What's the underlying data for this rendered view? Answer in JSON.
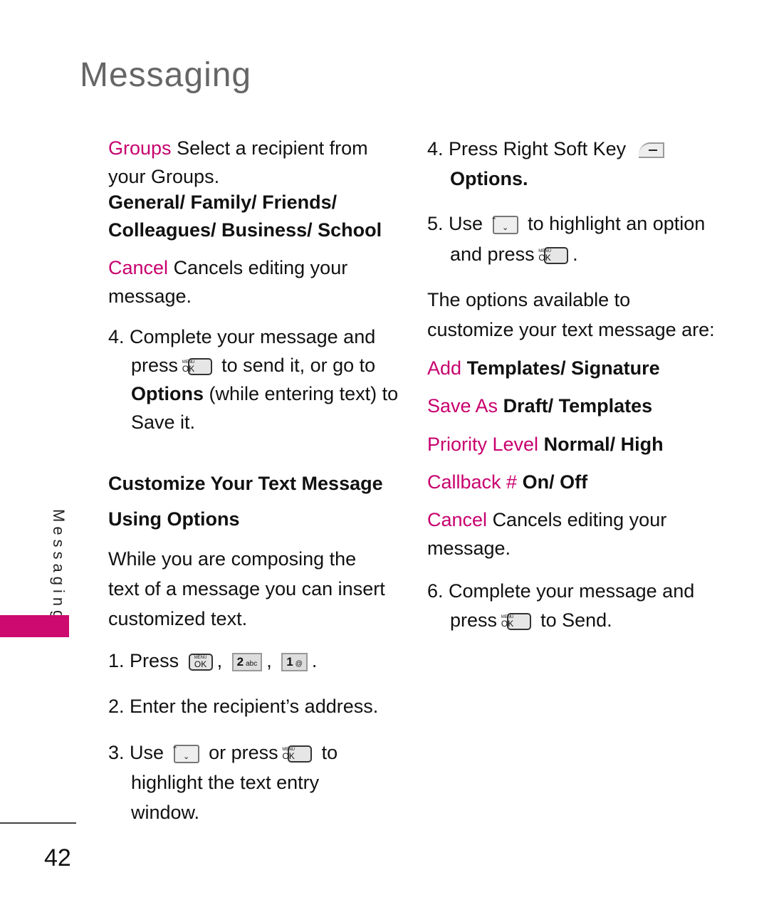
{
  "page_title": "Messaging",
  "side_tab": "Messaging",
  "page_number": "42",
  "left": {
    "groups": {
      "term": "Groups",
      "desc": "Select a recipient from your Groups.",
      "options": "General/ Family/ Friends/ Colleagues/ Business/ School"
    },
    "cancel": {
      "term": "Cancel",
      "desc": "Cancels editing your message."
    },
    "step4": {
      "num": "4.",
      "a": "Complete your message and press",
      "b": "to send it, or go to",
      "c": "Options",
      "d": "(while entering text) to Save it."
    },
    "heading": "Customize Your Text Message Using Options",
    "intro": "While you are composing the text of a message you can insert customized text.",
    "step1": {
      "num": "1.",
      "a": "Press",
      "sep": ",",
      "end": "."
    },
    "step2": {
      "num": "2.",
      "text": "Enter the recipient’s address."
    },
    "step3": {
      "num": "3.",
      "a": "Use",
      "b": "or press",
      "c": "to highlight the text entry window."
    }
  },
  "right": {
    "step4": {
      "num": "4.",
      "a": "Press Right Soft Key",
      "b": "Options."
    },
    "step5": {
      "num": "5.",
      "a": "Use",
      "b": "to highlight an option and press",
      "c": "."
    },
    "intro": "The options available to customize your text message are:",
    "options": [
      {
        "term": "Add",
        "value": "Templates/ Signature"
      },
      {
        "term": "Save As",
        "value": "Draft/ Templates"
      },
      {
        "term": "Priority Level",
        "value": "Normal/ High"
      },
      {
        "term": "Callback #",
        "value": "On/ Off"
      }
    ],
    "cancel": {
      "term": "Cancel",
      "desc": "Cancels editing your message."
    },
    "step6": {
      "num": "6.",
      "a": "Complete your message and press",
      "b": "to Send."
    }
  },
  "keys": {
    "menu": "MENU",
    "ok": "OK",
    "two": "2",
    "two_sub": "abc",
    "one": "1",
    "one_sub": "@",
    "nav_up": "⌃",
    "nav_down": "⌄"
  },
  "colors": {
    "accent": "#c8006e",
    "title_gray": "#666666"
  }
}
